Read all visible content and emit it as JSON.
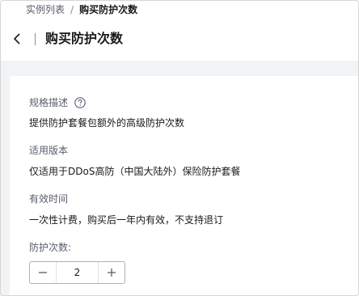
{
  "breadcrumb": {
    "parent": "实例列表",
    "separator": "/",
    "current": "购买防护次数"
  },
  "header": {
    "title": "购买防护次数",
    "back_icon": "chevron-left-icon"
  },
  "fields": {
    "spec": {
      "label": "规格描述",
      "help_icon": "question-circle-icon",
      "value": "提供防护套餐包额外的高级防护次数"
    },
    "version": {
      "label": "适用版本",
      "value": "仅适用于DDoS高防（中国大陆外）保险防护套餐"
    },
    "validity": {
      "label": "有效时间",
      "value": "一次性计费，购买后一年内有效，不支持退订"
    },
    "count": {
      "label": "防护次数:",
      "value": "2"
    }
  },
  "colors": {
    "page_bg": "#f2f3f5",
    "card_bg": "#ffffff",
    "text_primary": "#191919",
    "text_secondary": "#575d6c"
  }
}
